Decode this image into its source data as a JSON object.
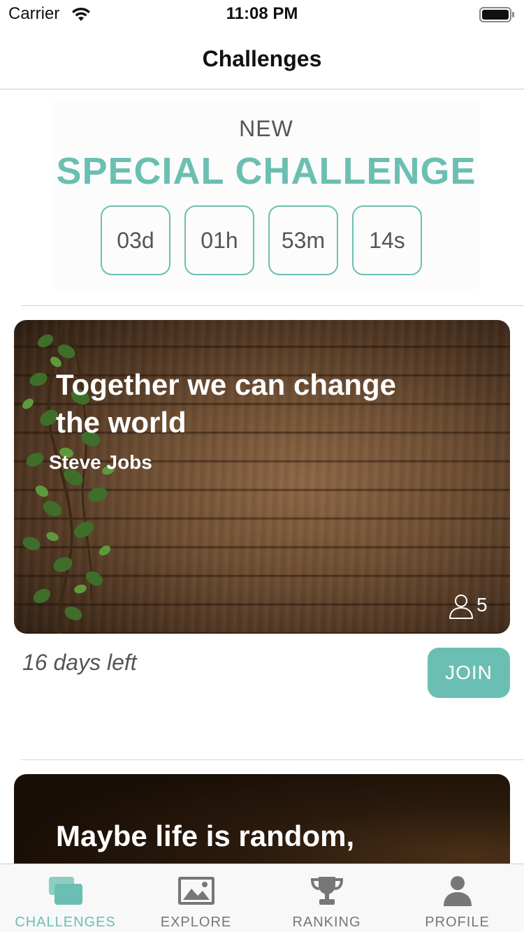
{
  "status_bar": {
    "carrier": "Carrier",
    "time": "11:08 PM"
  },
  "nav": {
    "title": "Challenges"
  },
  "special": {
    "label": "NEW",
    "title": "SPECIAL CHALLENGE",
    "countdown": {
      "days": "03d",
      "hours": "01h",
      "minutes": "53m",
      "seconds": "14s"
    }
  },
  "challenges": [
    {
      "title": "Together we can change the world",
      "author": "Steve Jobs",
      "participants": "5",
      "days_left": "16 days left",
      "join_label": "JOIN"
    },
    {
      "title": "Maybe life is random,"
    }
  ],
  "tabs": [
    {
      "label": "CHALLENGES",
      "icon": "challenges-icon",
      "active": true
    },
    {
      "label": "EXPLORE",
      "icon": "image-icon",
      "active": false
    },
    {
      "label": "RANKING",
      "icon": "trophy-icon",
      "active": false
    },
    {
      "label": "PROFILE",
      "icon": "person-icon",
      "active": false
    }
  ],
  "colors": {
    "accent": "#6bbfb2",
    "tab_inactive": "#777777",
    "text_secondary": "#555555"
  }
}
